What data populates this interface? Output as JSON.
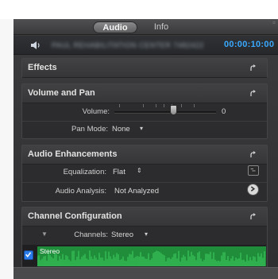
{
  "tabs": {
    "audio": "Audio",
    "info": "Info"
  },
  "clip": {
    "name": "PAUL REHABILITATION CENTER 7482422",
    "timecode": "00:00:10:00"
  },
  "effects": {
    "title": "Effects"
  },
  "volume_pan": {
    "title": "Volume and Pan",
    "volume_label": "Volume:",
    "volume_value": "0",
    "volume_level": 0.58,
    "pan_mode_label": "Pan Mode:",
    "pan_mode_value": "None"
  },
  "audio_enhancements": {
    "title": "Audio Enhancements",
    "equalization_label": "Equalization:",
    "equalization_value": "Flat",
    "analysis_label": "Audio Analysis:",
    "analysis_value": "Not Analyzed"
  },
  "channel_config": {
    "title": "Channel Configuration",
    "channels_label": "Channels:",
    "channels_value": "Stereo",
    "track_label": "Stereo",
    "track_checked": true
  },
  "colors": {
    "timecode": "#3aa9ff",
    "waveform": "#1f8d3a",
    "checkbox": "#2a7bea"
  },
  "icons": [
    "speaker-icon",
    "reset-arrow-icon",
    "chevron-down-icon",
    "stepper-icon",
    "eq-icon",
    "go-arrow-icon",
    "checkmark-icon",
    "disclosure-triangle-icon"
  ]
}
